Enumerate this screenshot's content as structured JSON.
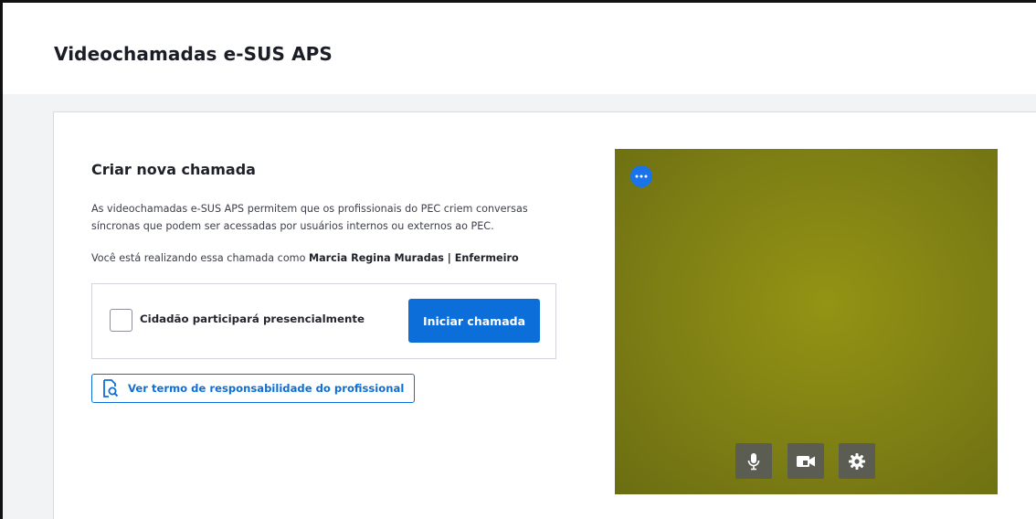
{
  "header": {
    "title": "Videochamadas e-SUS APS"
  },
  "create_call": {
    "title": "Criar nova chamada",
    "description_line1": "As videochamadas e-SUS APS permitem que os profissionais do PEC criem conversas",
    "description_line2": "síncronas que podem ser acessadas por usuários internos ou externos ao PEC.",
    "caller_prefix": "Você está realizando essa chamada como ",
    "caller_name": "Marcia Regina Muradas | Enfermeiro",
    "checkbox_label": "Cidadão participará presencialmente",
    "checkbox_checked": false,
    "start_button_label": "Iniciar chamada",
    "terms_button_label": "Ver termo de responsabilidade do profissional"
  },
  "video_preview": {
    "menu_icon": "more-horizontal-icon",
    "controls": [
      {
        "name": "microphone-icon"
      },
      {
        "name": "camera-icon"
      },
      {
        "name": "settings-gear-icon"
      }
    ]
  },
  "colors": {
    "primary": "#0c6fd9",
    "video_background": "#7e7f14",
    "control_background": "#5c5d52"
  }
}
